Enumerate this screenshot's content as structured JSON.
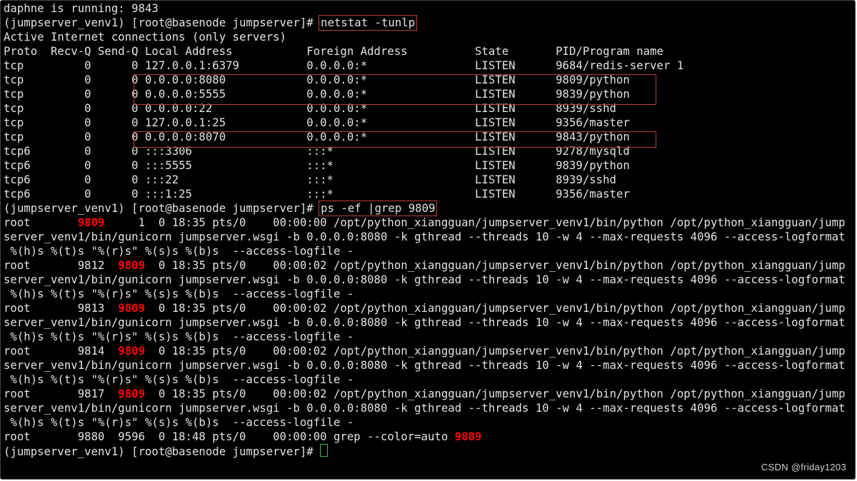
{
  "status_line": "daphne is running: 9843",
  "prompt1_prefix": "(jumpserver_venv1) [root@basenode jumpserver]# ",
  "cmd1": "netstat -tunlp",
  "active_line": "Active Internet connections (only servers)",
  "header": {
    "proto": "Proto",
    "recvq": "Recv-Q",
    "sendq": "Send-Q",
    "local": "Local Address",
    "foreign": "Foreign Address",
    "state": "State",
    "pid": "PID/Program name"
  },
  "netstat": [
    {
      "proto": "tcp",
      "recvq": "0",
      "sendq": "0",
      "local": "127.0.0.1:6379",
      "foreign": "0.0.0.0:*",
      "state": "LISTEN",
      "pid": "9684/redis-server 1"
    },
    {
      "proto": "tcp",
      "recvq": "0",
      "sendq": "0",
      "local": "0.0.0.0:8080",
      "foreign": "0.0.0.0:*",
      "state": "LISTEN",
      "pid": "9809/python"
    },
    {
      "proto": "tcp",
      "recvq": "0",
      "sendq": "0",
      "local": "0.0.0.0:5555",
      "foreign": "0.0.0.0:*",
      "state": "LISTEN",
      "pid": "9839/python"
    },
    {
      "proto": "tcp",
      "recvq": "0",
      "sendq": "0",
      "local": "0.0.0.0:22",
      "foreign": "0.0.0.0:*",
      "state": "LISTEN",
      "pid": "8939/sshd"
    },
    {
      "proto": "tcp",
      "recvq": "0",
      "sendq": "0",
      "local": "127.0.0.1:25",
      "foreign": "0.0.0.0:*",
      "state": "LISTEN",
      "pid": "9356/master"
    },
    {
      "proto": "tcp",
      "recvq": "0",
      "sendq": "0",
      "local": "0.0.0.0:8070",
      "foreign": "0.0.0.0:*",
      "state": "LISTEN",
      "pid": "9843/python"
    },
    {
      "proto": "tcp6",
      "recvq": "0",
      "sendq": "0",
      "local": ":::3306",
      "foreign": ":::*",
      "state": "LISTEN",
      "pid": "9278/mysqld"
    },
    {
      "proto": "tcp6",
      "recvq": "0",
      "sendq": "0",
      "local": ":::5555",
      "foreign": ":::*",
      "state": "LISTEN",
      "pid": "9839/python"
    },
    {
      "proto": "tcp6",
      "recvq": "0",
      "sendq": "0",
      "local": ":::22",
      "foreign": ":::*",
      "state": "LISTEN",
      "pid": "8939/sshd"
    },
    {
      "proto": "tcp6",
      "recvq": "0",
      "sendq": "0",
      "local": ":::1:25",
      "foreign": ":::*",
      "state": "LISTEN",
      "pid": "9356/master"
    }
  ],
  "prompt2_prefix": "(jumpserver_venv1) [root@basenode jumpserver]# ",
  "cmd2": "ps -ef |grep 9809",
  "ps_cmd_full": "/opt/python_xiangguan/jumpserver_venv1/bin/python /opt/python_xiangguan/jumpserver_venv1/bin/gunicorn jumpserver.wsgi -b 0.0.0.0:8080 -k gthread --threads 10 -w 4 --max-requests 4096 --access-logformat %(h)s %(t)s \"%(r)s\" %(s)s %(b)s  --access-logfile -",
  "ps": [
    {
      "user": "root",
      "pid": "9809",
      "ppid": "1",
      "c": "0",
      "stime": "18:35",
      "tty": "pts/0",
      "time": "00:00:00",
      "hl": "pid"
    },
    {
      "user": "root",
      "pid": "9812",
      "ppid": "9809",
      "c": "0",
      "stime": "18:35",
      "tty": "pts/0",
      "time": "00:00:02",
      "hl": "ppid"
    },
    {
      "user": "root",
      "pid": "9813",
      "ppid": "9809",
      "c": "0",
      "stime": "18:35",
      "tty": "pts/0",
      "time": "00:00:02",
      "hl": "ppid"
    },
    {
      "user": "root",
      "pid": "9814",
      "ppid": "9809",
      "c": "0",
      "stime": "18:35",
      "tty": "pts/0",
      "time": "00:00:02",
      "hl": "ppid"
    },
    {
      "user": "root",
      "pid": "9817",
      "ppid": "9809",
      "c": "0",
      "stime": "18:35",
      "tty": "pts/0",
      "time": "00:00:02",
      "hl": "ppid"
    }
  ],
  "grep_line": {
    "user": "root",
    "pid": "9880",
    "ppid": "9596",
    "c": "0",
    "stime": "18:48",
    "tty": "pts/0",
    "time": "00:00:00",
    "cmd_pre": "grep --color=auto ",
    "cmd_hl": "9809"
  },
  "prompt3_prefix": "(jumpserver_venv1) [root@basenode jumpserver]# ",
  "watermark": "CSDN @friday1203"
}
